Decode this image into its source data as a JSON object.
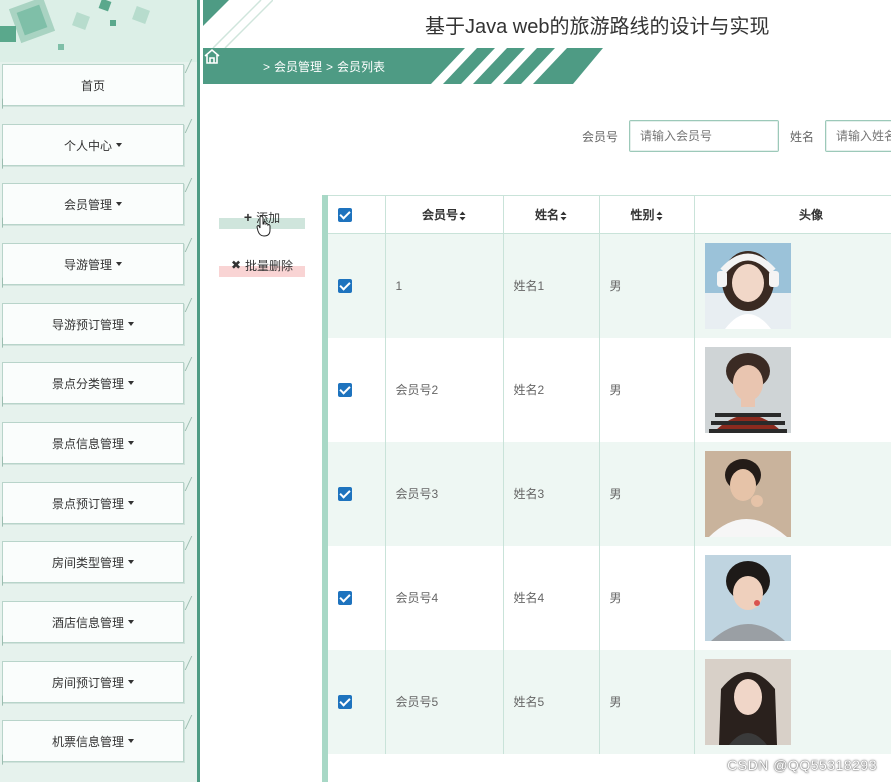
{
  "header": {
    "title": "基于Java web的旅游路线的设计与实现"
  },
  "breadcrumb": {
    "sep": ">",
    "level1": "会员管理",
    "level2": "会员列表"
  },
  "sidebar": {
    "items": [
      {
        "label": "首页",
        "dropdown": false
      },
      {
        "label": "个人中心",
        "dropdown": true
      },
      {
        "label": "会员管理",
        "dropdown": true
      },
      {
        "label": "导游管理",
        "dropdown": true
      },
      {
        "label": "导游预订管理",
        "dropdown": true
      },
      {
        "label": "景点分类管理",
        "dropdown": true
      },
      {
        "label": "景点信息管理",
        "dropdown": true
      },
      {
        "label": "景点预订管理",
        "dropdown": true
      },
      {
        "label": "房间类型管理",
        "dropdown": true
      },
      {
        "label": "酒店信息管理",
        "dropdown": true
      },
      {
        "label": "房间预订管理",
        "dropdown": true
      },
      {
        "label": "机票信息管理",
        "dropdown": true
      }
    ]
  },
  "search": {
    "member_no_label": "会员号",
    "member_no_placeholder": "请输入会员号",
    "name_label": "姓名",
    "name_placeholder": "请输入姓名"
  },
  "actions": {
    "add_label": "添加",
    "batch_delete_label": "批量删除"
  },
  "table": {
    "columns": [
      "会员号",
      "姓名",
      "性别",
      "头像"
    ],
    "rows": [
      {
        "member_no": "1",
        "name": "姓名1",
        "gender": "男",
        "checked": true,
        "avatar": "avatar-girl-headphones"
      },
      {
        "member_no": "会员号2",
        "name": "姓名2",
        "gender": "男",
        "checked": true,
        "avatar": "avatar-boy-striped-shirt"
      },
      {
        "member_no": "会员号3",
        "name": "姓名3",
        "gender": "男",
        "checked": true,
        "avatar": "avatar-boy-white-shirt"
      },
      {
        "member_no": "会员号4",
        "name": "姓名4",
        "gender": "男",
        "checked": true,
        "avatar": "avatar-boy-grey-hoodie"
      },
      {
        "member_no": "会员号5",
        "name": "姓名5",
        "gender": "男",
        "checked": true,
        "avatar": "avatar-girl-long-hair"
      }
    ]
  },
  "watermark": "CSDN @QQ55318293",
  "colors": {
    "accent": "#4e9b84",
    "sidebar_bg": "#e6f2ed",
    "checkbox": "#1e73be",
    "row_alt": "#eef7f3"
  }
}
